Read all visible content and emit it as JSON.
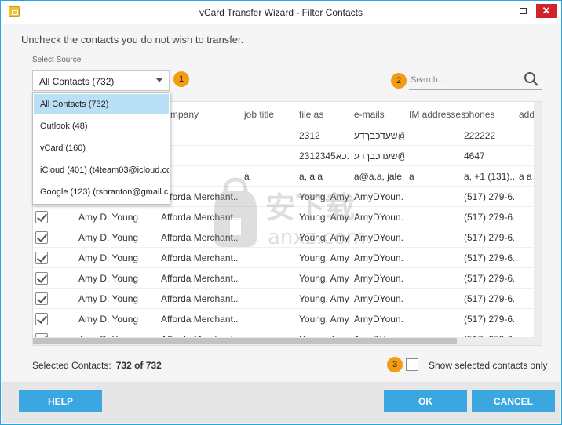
{
  "window": {
    "title": "vCard Transfer Wizard - Filter Contacts",
    "close_glyph": "✕"
  },
  "instruction": "Uncheck the contacts you do not wish to transfer.",
  "source": {
    "label": "Select Source",
    "selected": "All Contacts (732)",
    "options": [
      "All Contacts (732)",
      "Outlook (48)",
      "vCard (160)",
      "iCloud (401) (t4team03@icloud.co...",
      "Google (123) (rsbranton@gmail.c..."
    ]
  },
  "badges": [
    "1",
    "2",
    "3"
  ],
  "search": {
    "placeholder": "Search..."
  },
  "table": {
    "headers": [
      "mpany",
      "job title",
      "file as",
      "e-mails",
      "IM addresses",
      "phones",
      "add"
    ],
    "rows": [
      {
        "checked": false,
        "name": "",
        "company": "",
        "job": "",
        "fileas": "2312",
        "email": "שעדכבךדע@",
        "im": "",
        "phone": "222222",
        "addr": ""
      },
      {
        "checked": false,
        "name": "",
        "company": "",
        "job": "",
        "fileas": "2312345כא...",
        "email": "שעדכבךדע@",
        "im": "",
        "phone": "4647",
        "addr": ""
      },
      {
        "checked": false,
        "name": "",
        "company": "",
        "job": "a",
        "fileas": "a, a a",
        "email": "a@a.a, jale...",
        "im": "a",
        "phone": "a, +1 (131)...",
        "addr": "a a a"
      },
      {
        "checked": false,
        "name": "",
        "company": "Afforda Merchant...",
        "job": "",
        "fileas": "Young, Amy...",
        "email": "AmyDYoun...",
        "im": "",
        "phone": "(517) 279-6...",
        "addr": ""
      },
      {
        "checked": true,
        "name": "Amy D. Young",
        "company": "Afforda Merchant...",
        "job": "",
        "fileas": "Young, Amy...",
        "email": "AmyDYoun...",
        "im": "",
        "phone": "(517) 279-6...",
        "addr": ""
      },
      {
        "checked": true,
        "name": "Amy D. Young",
        "company": "Afforda Merchant...",
        "job": "",
        "fileas": "Young, Amy...",
        "email": "AmyDYoun...",
        "im": "",
        "phone": "(517) 279-6...",
        "addr": ""
      },
      {
        "checked": true,
        "name": "Amy D. Young",
        "company": "Afforda Merchant...",
        "job": "",
        "fileas": "Young, Amy...",
        "email": "AmyDYoun...",
        "im": "",
        "phone": "(517) 279-6...",
        "addr": ""
      },
      {
        "checked": true,
        "name": "Amy D. Young",
        "company": "Afforda Merchant...",
        "job": "",
        "fileas": "Young, Amy...",
        "email": "AmyDYoun...",
        "im": "",
        "phone": "(517) 279-6...",
        "addr": ""
      },
      {
        "checked": true,
        "name": "Amy D. Young",
        "company": "Afforda Merchant...",
        "job": "",
        "fileas": "Young, Amy...",
        "email": "AmyDYoun...",
        "im": "",
        "phone": "(517) 279-6...",
        "addr": ""
      },
      {
        "checked": true,
        "name": "Amy D. Young",
        "company": "Afforda Merchant...",
        "job": "",
        "fileas": "Young, Amy...",
        "email": "AmyDYoun...",
        "im": "",
        "phone": "(517) 279-6...",
        "addr": ""
      },
      {
        "checked": true,
        "name": "Amy D. Young",
        "company": "Afforda Merchant...",
        "job": "",
        "fileas": "Young, Amy...",
        "email": "AmyDYoun...",
        "im": "",
        "phone": "(517) 279-6...",
        "addr": ""
      }
    ]
  },
  "watermark": {
    "big": "安下载",
    "small": "anxz.com"
  },
  "selected": {
    "label": "Selected Contacts:",
    "value": "732 of 732"
  },
  "show_selected": {
    "label": "Show selected contacts only",
    "checked": false
  },
  "buttons": {
    "help": "HELP",
    "ok": "OK",
    "cancel": "CANCEL"
  },
  "colors": {
    "accent": "#3aa7e0",
    "badge": "#f39c12",
    "close": "#d3232a",
    "selection": "#b9e0f5"
  }
}
